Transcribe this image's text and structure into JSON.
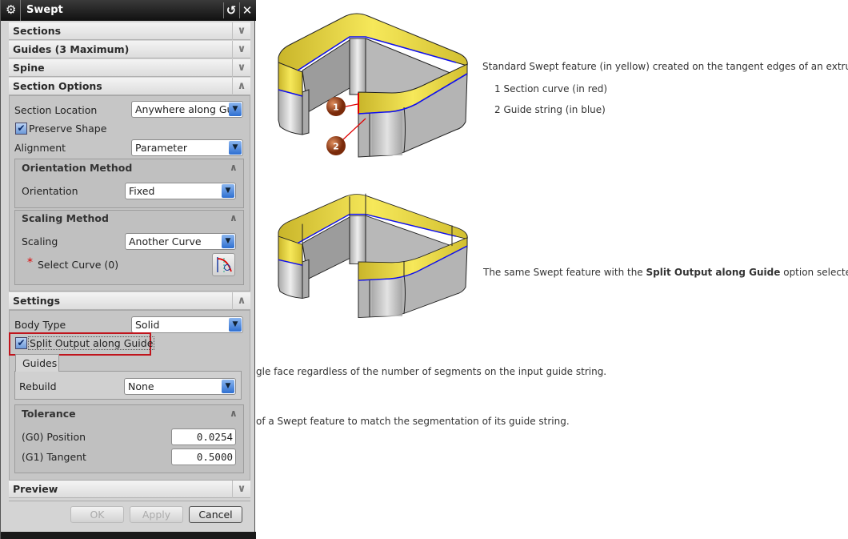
{
  "dialog": {
    "title": "Swept",
    "groups": {
      "sections": "Sections",
      "guides": "Guides (3 Maximum)",
      "spine": "Spine",
      "section_options": "Section Options",
      "settings": "Settings",
      "preview": "Preview"
    },
    "section_options": {
      "section_location_label": "Section Location",
      "section_location_value": "Anywhere along Gu",
      "preserve_shape_label": "Preserve Shape",
      "preserve_shape_checked": true,
      "alignment_label": "Alignment",
      "alignment_value": "Parameter",
      "orientation_method": {
        "title": "Orientation Method",
        "orientation_label": "Orientation",
        "orientation_value": "Fixed"
      },
      "scaling_method": {
        "title": "Scaling Method",
        "scaling_label": "Scaling",
        "scaling_value": "Another Curve",
        "required_marker": "*",
        "select_curve_label": "Select Curve (0)"
      }
    },
    "settings": {
      "body_type_label": "Body Type",
      "body_type_value": "Solid",
      "split_output_label": "Split Output along Guide",
      "split_output_checked": true,
      "tab_guides": "Guides",
      "rebuild_label": "Rebuild",
      "rebuild_value": "None",
      "tolerance": {
        "title": "Tolerance",
        "g0_label": "(G0) Position",
        "g0_value": "0.0254",
        "g1_label": "(G1) Tangent",
        "g1_value": "0.5000"
      }
    },
    "buttons": {
      "ok": "OK",
      "apply": "Apply",
      "cancel": "Cancel"
    }
  },
  "document": {
    "caption1": "Standard Swept feature (in yellow) created on the tangent edges of an extrude",
    "item1": "1 Section curve (in red)",
    "item2": "2 Guide string (in blue)",
    "callout1": "1",
    "callout2": "2",
    "caption2_pre": "The same Swept feature with the ",
    "caption2_bold": "Split Output along Guide",
    "caption2_post": " option selected.",
    "line3": "gle face regardless of the number of segments on the input guide string.",
    "line4": "of a Swept feature to match the segmentation of its guide string."
  },
  "colors": {
    "sweep_yellow": "#e8d43a",
    "section_red": "#e00000",
    "guide_blue": "#1010ee",
    "highlight_box": "#c0141c",
    "callout": "#9a3a16"
  }
}
